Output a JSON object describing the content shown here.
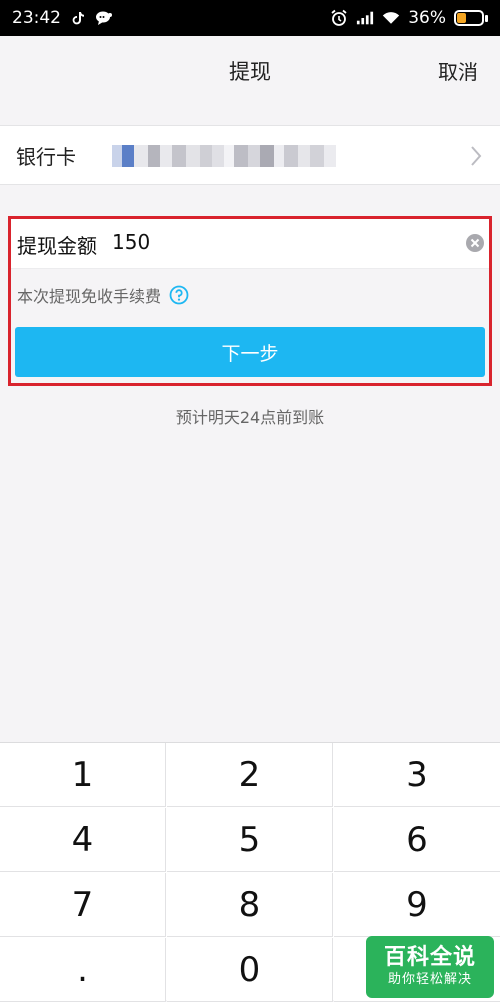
{
  "status_bar": {
    "time": "23:42",
    "battery_percent": "36%",
    "battery_level": 0.36,
    "left_icons": [
      "tiktok-icon",
      "chat-bubble-icon"
    ],
    "right_icons": [
      "alarm-icon",
      "signal-icon",
      "wifi-icon",
      "battery-icon"
    ]
  },
  "header": {
    "title": "提现",
    "cancel_label": "取消"
  },
  "bank_card": {
    "label": "银行卡",
    "masked_info_icon": "pixelated-redaction"
  },
  "withdraw": {
    "amount_label": "提现金额",
    "amount_value": "150",
    "fee_note": "本次提现免收手续费",
    "next_label": "下一步",
    "highlight_color": "#d9232d",
    "button_color": "#1db7f2"
  },
  "arrival_note": "预计明天24点前到账",
  "keypad": {
    "keys": [
      "1",
      "2",
      "3",
      "4",
      "5",
      "6",
      "7",
      "8",
      "9",
      ".",
      "0",
      ""
    ]
  },
  "watermark": {
    "title": "百科全说",
    "subtitle": "助你轻松解决",
    "color": "#2bb35b"
  }
}
